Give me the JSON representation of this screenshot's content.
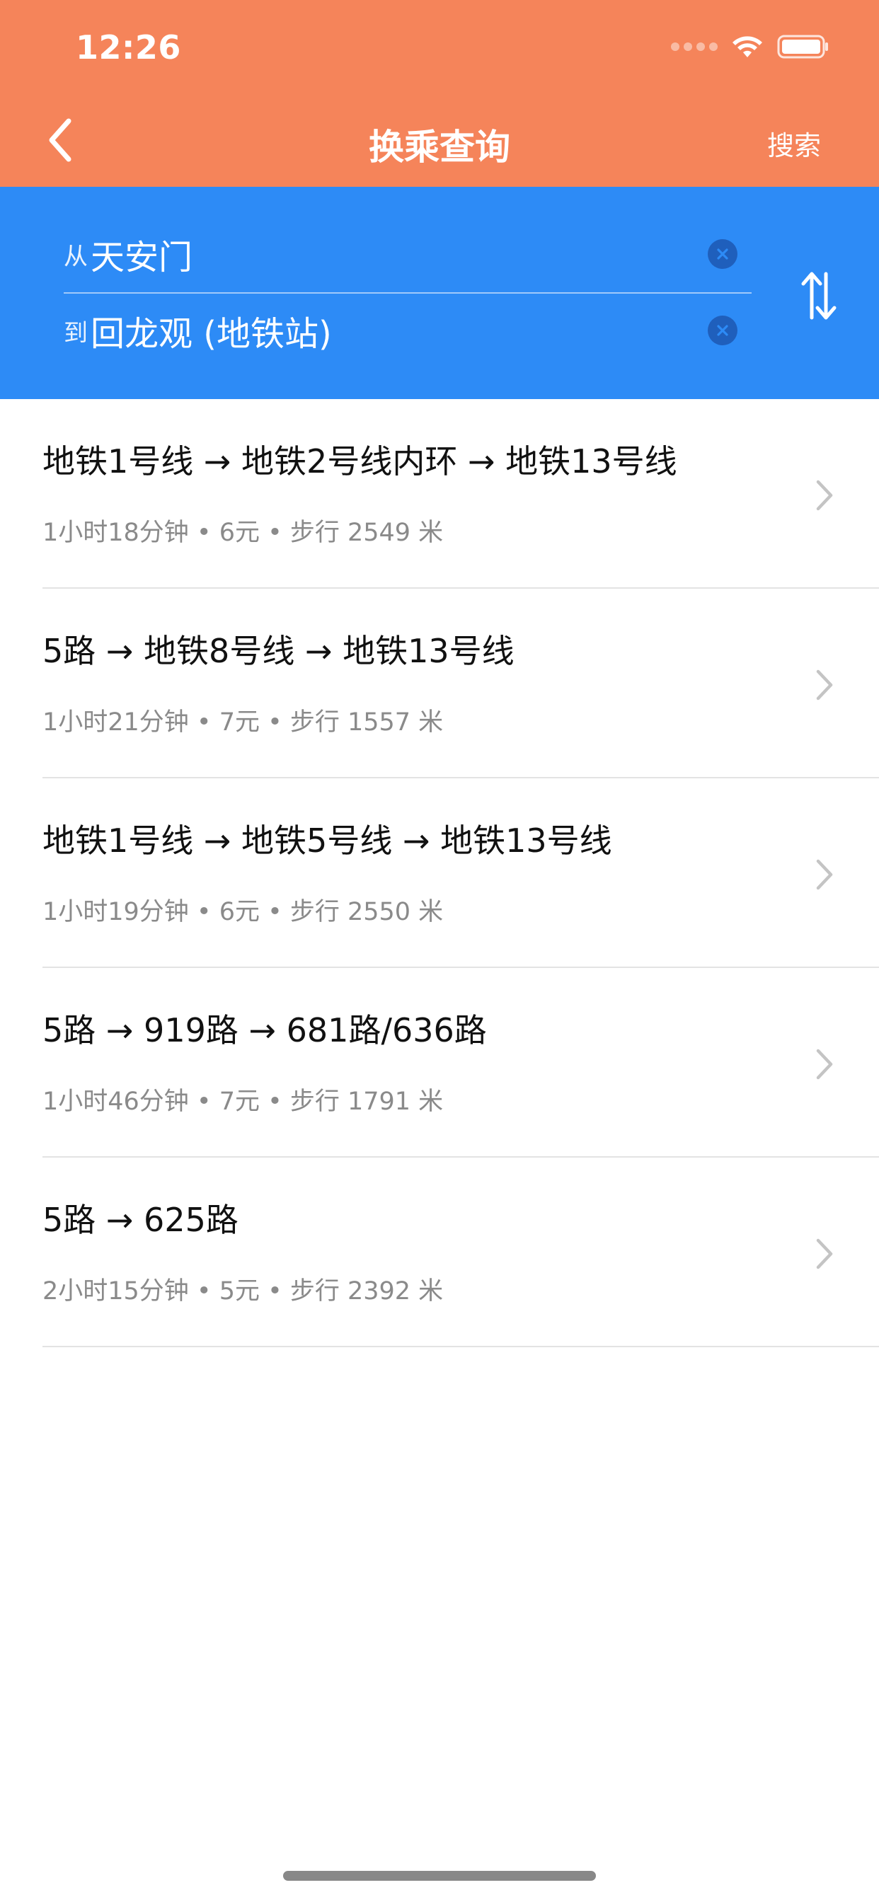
{
  "status_bar": {
    "time": "12:26"
  },
  "nav": {
    "title": "换乘查询",
    "search_label": "搜索"
  },
  "query": {
    "from_prefix": "从",
    "from_value": "天安门",
    "to_prefix": "到",
    "to_value": "回龙观 (地铁站)"
  },
  "routes": [
    {
      "title": "地铁1号线 → 地铁2号线内环 → 地铁13号线",
      "meta": "1小时18分钟 • 6元 • 步行 2549 米"
    },
    {
      "title": "5路 → 地铁8号线 → 地铁13号线",
      "meta": "1小时21分钟 • 7元 • 步行 1557 米"
    },
    {
      "title": "地铁1号线 → 地铁5号线 → 地铁13号线",
      "meta": "1小时19分钟 • 6元 • 步行 2550 米"
    },
    {
      "title": "5路 → 919路 → 681路/636路",
      "meta": "1小时46分钟 • 7元 • 步行 1791 米"
    },
    {
      "title": "5路 → 625路",
      "meta": "2小时15分钟 • 5元 • 步行 2392 米"
    }
  ],
  "colors": {
    "header": "#F5845A",
    "search_panel": "#2D8BF6",
    "text_primary": "#111111",
    "text_secondary": "#8A8A8A"
  },
  "icons": {
    "back": "chevron-left-icon",
    "clear": "clear-circle-icon",
    "swap": "swap-vertical-icon",
    "row": "chevron-right-icon"
  }
}
